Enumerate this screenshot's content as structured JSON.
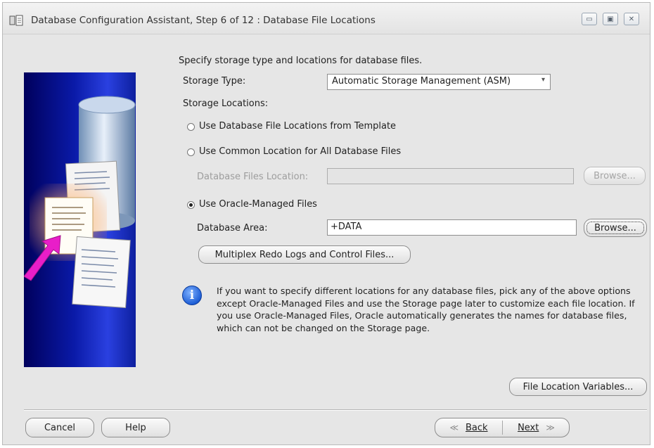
{
  "window": {
    "title": "Database Configuration Assistant, Step 6 of 12 : Database File Locations",
    "controls": {
      "minimize": "▭",
      "maximize": "▣",
      "close": "✕"
    }
  },
  "main": {
    "intro": "Specify storage type and locations for database files.",
    "storage_type_label": "Storage Type:",
    "storage_type_value": "Automatic Storage Management (ASM)",
    "storage_locations_label": "Storage Locations:",
    "options": {
      "template": "Use Database File Locations from Template",
      "common": "Use Common Location for All Database Files",
      "omf": "Use Oracle-Managed Files"
    },
    "selected_option": "omf",
    "db_files_location_label": "Database Files Location:",
    "db_files_location_value": "",
    "browse_label": "Browse...",
    "database_area_label": "Database Area:",
    "database_area_value": "+DATA",
    "multiplex_button": "Multiplex Redo Logs and Control Files...",
    "info_text": "If you want to specify different locations for any database files, pick any of the above options except Oracle-Managed Files and use the Storage page later to customize each file location. If you use Oracle-Managed Files, Oracle automatically generates the names for database files, which can not be changed on the Storage page.",
    "file_location_variables_button": "File Location Variables..."
  },
  "footer": {
    "cancel": "Cancel",
    "help": "Help",
    "back": "Back",
    "next": "Next"
  },
  "colors": {
    "dialog_bg": "#e6e6e6",
    "panel_blue": "#0a1aa8",
    "accent_magenta": "#e81ec8",
    "info_blue": "#1f5fd6"
  },
  "icons": {
    "app": "database-config-icon",
    "info": "info-icon",
    "combo": "dropdown-arrow-icon",
    "back": "double-chevron-left-icon",
    "next": "double-chevron-right-icon"
  }
}
